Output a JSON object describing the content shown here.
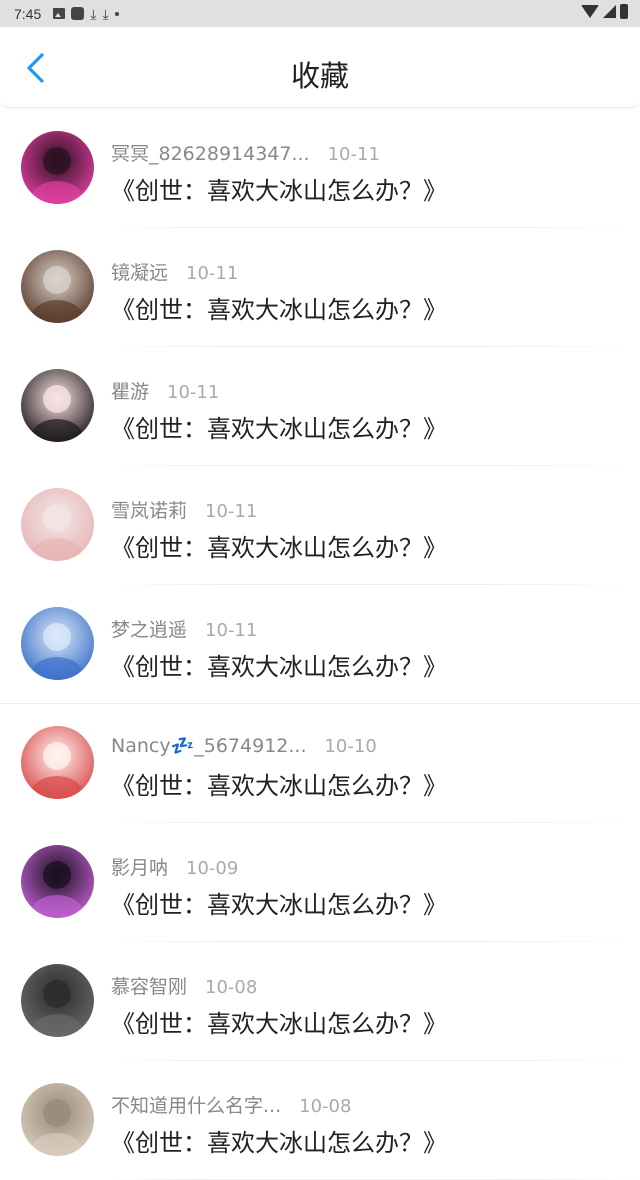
{
  "status_bar": {
    "time": "7:45",
    "left_icons": [
      "image-icon",
      "square-icon",
      "download-icon",
      "download-icon",
      "dot-icon"
    ],
    "right_icons": [
      "wifi-icon",
      "signal-icon",
      "battery-icon"
    ]
  },
  "header": {
    "back_icon": "chevron-left-icon",
    "title": "收藏",
    "accent_color": "#2196f3"
  },
  "items": [
    {
      "user": "冥冥_82628914347...",
      "date": "10-11",
      "content": "《创世：喜欢大冰山怎么办？》",
      "avatar_colors": [
        "#2a1020",
        "#e040a0"
      ]
    },
    {
      "user": "镜凝远",
      "date": "10-11",
      "content": "《创世：喜欢大冰山怎么办？》",
      "avatar_colors": [
        "#d9d2cc",
        "#5a3a2a"
      ]
    },
    {
      "user": "瞿游",
      "date": "10-11",
      "content": "《创世：喜欢大冰山怎么办？》",
      "avatar_colors": [
        "#fbe3e6",
        "#1e1a1a"
      ]
    },
    {
      "user": "雪岚诺莉",
      "date": "10-11",
      "content": "《创世：喜欢大冰山怎么办？》",
      "avatar_colors": [
        "#f3e6e6",
        "#e6b5b5"
      ]
    },
    {
      "user": "梦之逍遥",
      "date": "10-11",
      "content": "《创世：喜欢大冰山怎么办？》",
      "avatar_colors": [
        "#dbe8f8",
        "#3b6fc9"
      ]
    },
    {
      "user": "Nancy💤_5674912...",
      "date": "10-10",
      "content": "《创世：喜欢大冰山怎么办？》",
      "avatar_colors": [
        "#fff3ee",
        "#d84a4a"
      ]
    },
    {
      "user": "影月呐",
      "date": "10-09",
      "content": "《创世：喜欢大冰山怎么办？》",
      "avatar_colors": [
        "#1a1020",
        "#c060d0"
      ]
    },
    {
      "user": "慕容智刚",
      "date": "10-08",
      "content": "《创世：喜欢大冰山怎么办？》",
      "avatar_colors": [
        "#2b2b2b",
        "#6a6a6a"
      ]
    },
    {
      "user": "不知道用什么名字...",
      "date": "10-08",
      "content": "《创世：喜欢大冰山怎么办？》",
      "avatar_colors": [
        "#9a8a78",
        "#d8ccbc"
      ]
    }
  ]
}
